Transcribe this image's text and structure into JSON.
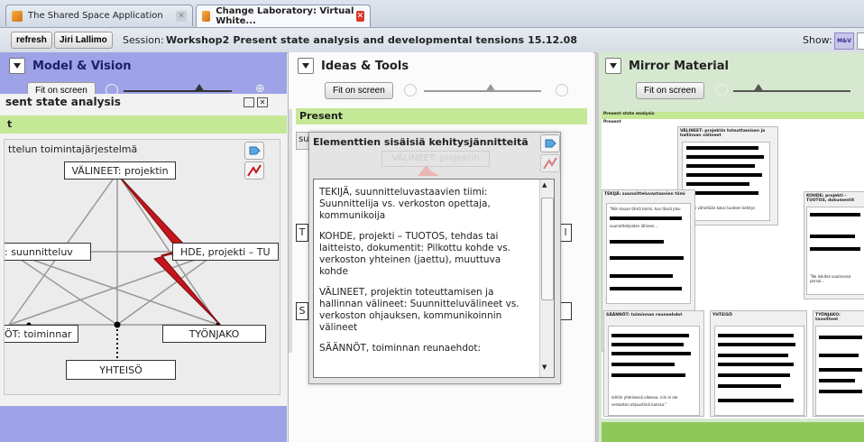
{
  "browser": {
    "tabs": [
      {
        "title": "The Shared Space Application",
        "active": false
      },
      {
        "title": "Change Laboratory: Virtual White...",
        "active": true
      }
    ]
  },
  "toolbar": {
    "refresh_label": "refresh",
    "user_label": "Jiri Lallimo",
    "session_label": "Session:",
    "session_name": "Workshop2 Present state analysis and developmental tensions 15.12.08",
    "show_label": "Show:",
    "show_badge": "M&V"
  },
  "panels": {
    "model_vision": {
      "title": "Model & Vision",
      "fit_label": "Fit on screen",
      "subtitle": "sent state analysis",
      "section": "t",
      "diagram_title": "ttelun toimintajärjestelmä",
      "nodes": {
        "top": "VÄLINEET: projektin",
        "left": ": suunnitteluv",
        "right": "HDE, projekti – TU",
        "bottom_left": "ÖT: toiminnar",
        "bottom_right": "TYÖNJAKO",
        "bottom": "YHTEISÖ"
      }
    },
    "ideas_tools": {
      "title": "Ideas & Tools",
      "fit_label": "Fit on screen",
      "section": "Present",
      "card_prefix": "su",
      "card_title": "Elementtien sisäisiä kehitysjännitteitä",
      "ghost_label": "VÄLINEET: projektin",
      "side_letters": [
        "T",
        "S"
      ],
      "right_fragment": "l",
      "paragraphs": [
        "TEKIJÄ, suunnitteluvastaavien tiimi: Suunnittelija vs. verkoston opettaja, kommunikoija",
        "KOHDE, projekti – TUOTOS, tehdas tai laitteisto, dokumentit: Pilkottu kohde vs. verkoston yhteinen (jaettu), muuttuva kohde",
        "VÄLINEET, projektin toteuttamisen ja hallinnan välineet: Suunnitteluvälineet vs. verkoston ohjauksen, kommunikoinnin välineet",
        "SÄÄNNÖT, toiminnan reunaehdot:"
      ]
    },
    "mirror": {
      "title": "Mirror Material",
      "fit_label": "Fit on screen",
      "doc_header": "Present state analysis",
      "doc_sub": "Present",
      "cards": [
        {
          "title": "VÄLINEET: projektin toteuttamisen ja hallinnan välineet"
        },
        {
          "title": "TEKIJÄ: suunnitteluvastaavien tiimi"
        },
        {
          "title": "KOHDE: projekti – TUOTOS, dokumentit"
        },
        {
          "title": "SÄÄNNÖT: toiminnan reunaehdot"
        },
        {
          "title": "YHTEISÖ"
        },
        {
          "title": "TYÖNJAKO: tavoitteet"
        }
      ],
      "snippets": [
        "\"Niin kauan tämä toimii, kun tässä joku",
        "suunnittelijoiden lähinen...",
        "Vaatii vähintään kaksi tuoteen kehitys",
        "\"Ne leikitse vuorisessa porsai...",
        "lehtiin yhteisessä oikeesa, niin ei ole",
        "verkoston ohjaustiinä kanssa.\""
      ]
    }
  }
}
